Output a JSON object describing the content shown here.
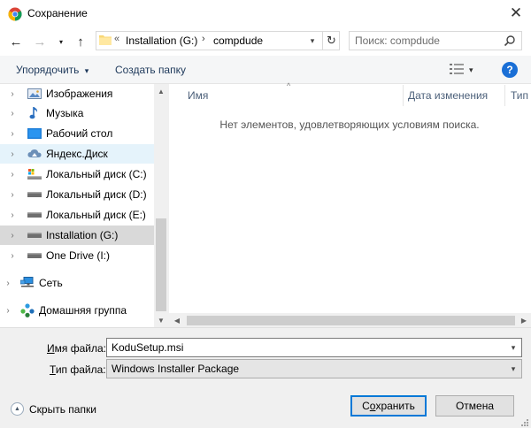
{
  "window": {
    "title": "Сохранение",
    "close_glyph": "✕"
  },
  "nav": {
    "back_glyph": "←",
    "forward_glyph": "→",
    "recent_glyph": "▾",
    "up_glyph": "↑"
  },
  "address": {
    "overflow_glyph": "«",
    "segment1": "Installation (G:)",
    "separator": "›",
    "segment2": "compdude",
    "dropdown_glyph": "▾",
    "refresh_glyph": "↻"
  },
  "search": {
    "placeholder": "Поиск: compdude"
  },
  "toolbar": {
    "organize_label": "Упорядочить",
    "organize_arrow": "▾",
    "new_folder_label": "Создать папку",
    "view_arrow": "▾",
    "help_label": "?"
  },
  "sidebar": {
    "items": [
      {
        "label": "Изображения",
        "icon": "pictures-icon",
        "expander": "›"
      },
      {
        "label": "Музыка",
        "icon": "music-icon",
        "expander": "›"
      },
      {
        "label": "Рабочий стол",
        "icon": "desktop-icon",
        "expander": "›"
      },
      {
        "label": "Яндекс.Диск",
        "icon": "yandex-disk-icon",
        "expander": "›"
      },
      {
        "label": "Локальный диск (C:)",
        "icon": "system-drive-icon",
        "expander": "›"
      },
      {
        "label": "Локальный диск (D:)",
        "icon": "drive-icon",
        "expander": "›"
      },
      {
        "label": "Локальный диск (E:)",
        "icon": "drive-icon",
        "expander": "›"
      },
      {
        "label": "Installation (G:)",
        "icon": "drive-icon",
        "expander": "›"
      },
      {
        "label": "One Drive (I:)",
        "icon": "drive-icon",
        "expander": "›"
      },
      {
        "label": "Сеть",
        "icon": "network-icon",
        "expander": "›"
      },
      {
        "label": "Домашняя группа",
        "icon": "homegroup-icon",
        "expander": "›"
      }
    ],
    "selected_index": 7,
    "hover_index": 3
  },
  "list": {
    "columns": [
      "Имя",
      "Дата изменения",
      "Тип"
    ],
    "sort_glyph": "^",
    "empty_message": "Нет элементов, удовлетворяющих условиям поиска."
  },
  "scrollbars": {
    "up_glyph": "▲",
    "down_glyph": "▼",
    "left_glyph": "◀",
    "right_glyph": "▶"
  },
  "form": {
    "filename_label": "Имя файла:",
    "filename_label_underline": "И",
    "filename_label_rest": "мя файла:",
    "filename_value": "KoduSetup.msi",
    "filetype_label_underline": "Т",
    "filetype_label_rest": "ип файла:",
    "filetype_value": "Windows Installer Package",
    "dropdown_glyph": "▾"
  },
  "footer": {
    "hide_folders_label": "Скрыть папки",
    "hide_folders_glyph": "▲",
    "save_underline": "о",
    "save_pre": "С",
    "save_post": "хранить",
    "cancel_label": "Отмена"
  },
  "colors": {
    "accent": "#0078d7",
    "selected_bg": "#d9d9d9",
    "hover_bg": "#e5f3fb",
    "header_text": "#4c607a"
  }
}
